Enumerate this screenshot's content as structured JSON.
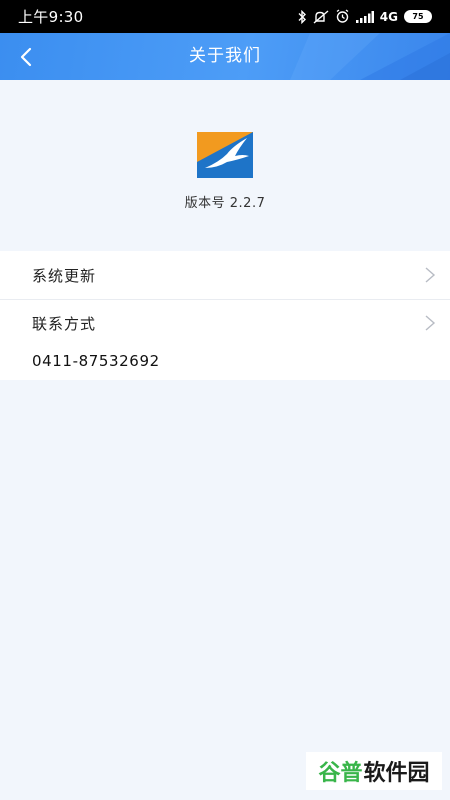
{
  "status_bar": {
    "time": "上午9:30",
    "network": "4G",
    "battery": "75"
  },
  "nav": {
    "title": "关于我们"
  },
  "about": {
    "version": "版本号 2.2.7"
  },
  "list": {
    "items": [
      {
        "label": "系统更新"
      },
      {
        "label": "联系方式",
        "value": "0411-87532692"
      }
    ]
  },
  "watermark": {
    "part_a": "谷普",
    "part_b": "软件园"
  },
  "colors": {
    "nav_blue": "#4d9df7",
    "logo_orange": "#f29a1f",
    "logo_blue": "#1e74c8",
    "background": "#f2f6fc"
  }
}
